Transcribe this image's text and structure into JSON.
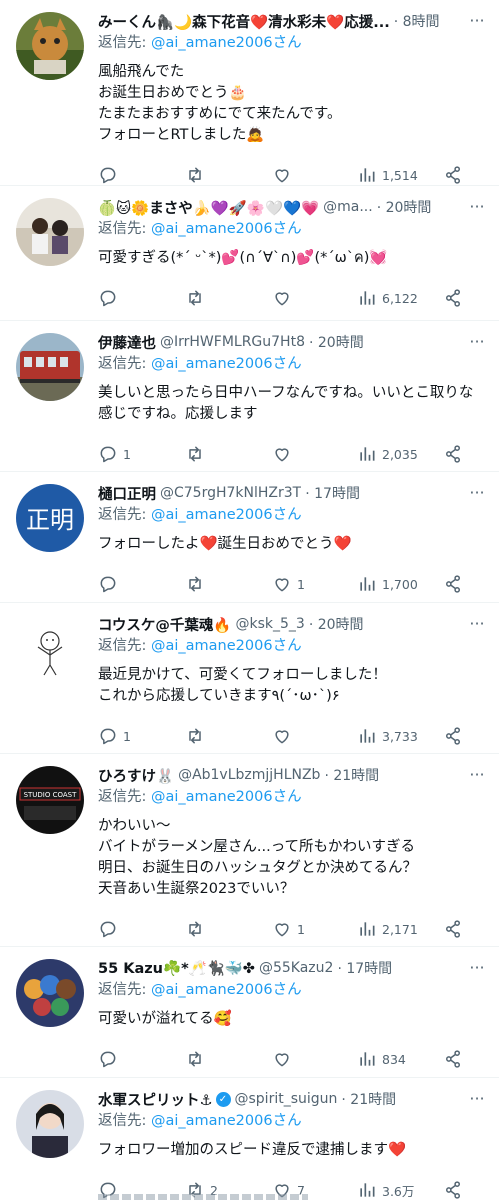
{
  "reply_prefix": "返信先:",
  "reply_target": "@ai_amane2006さん",
  "more_glyph": "···",
  "tweets": [
    {
      "name": "みーくん🦍🌙森下花音❤️清水彩未❤️応援...",
      "handle": "",
      "time": "· 8時間",
      "body": "風船飛んでた\nお誕生日おめでとう🎂\nたまたまおすすめにでて来たんです。\nフォローとRTしました🙇",
      "reply_count": "",
      "retweet_count": "",
      "like_count": "",
      "views": "1,514"
    },
    {
      "name": "🍈🐱🌼まさや🍌💜🚀🌸🤍💙💗",
      "handle": "@ma...",
      "time": "· 20時間",
      "body": "可愛すぎる(*´ ᵕ`*)💕(∩´∀`∩)💕(*´ω`ค)💓",
      "reply_count": "",
      "retweet_count": "",
      "like_count": "",
      "views": "6,122"
    },
    {
      "name": "伊藤達也",
      "handle": "@IrrHWFMLRGu7Ht8",
      "time": "· 20時間",
      "body": "美しいと思ったら日中ハーフなんですね。いいとこ取りな感じですね。応援します",
      "reply_count": "1",
      "retweet_count": "",
      "like_count": "",
      "views": "2,035"
    },
    {
      "name": "樋口正明",
      "handle": "@C75rgH7kNlHZr3T",
      "time": "· 17時間",
      "body": "フォローしたよ❤️誕生日おめでとう❤️",
      "reply_count": "",
      "retweet_count": "",
      "like_count": "1",
      "views": "1,700",
      "avatar_text": "正明"
    },
    {
      "name": "コウスケ@千葉魂🔥",
      "handle": "@ksk_5_3",
      "time": "· 20時間",
      "body": "最近見かけて、可愛くてフォローしました！\nこれから応援していきます٩(´･ω･`)۶",
      "reply_count": "1",
      "retweet_count": "",
      "like_count": "",
      "views": "3,733"
    },
    {
      "name": "ひろすけ🐰",
      "handle": "@Ab1vLbzmjjHLNZb",
      "time": "· 21時間",
      "body": "かわいい〜\nバイトがラーメン屋さん...って所もかわいすぎる\n明日、お誕生日のハッシュタグとか決めてるん？\n天音あい生誕祭2023でいい？",
      "reply_count": "",
      "retweet_count": "",
      "like_count": "1",
      "views": "2,171",
      "avatar_text": "STUDIO COAST"
    },
    {
      "name": "55 Kazu☘️*🥂🐈‍⬛🐳✤",
      "handle": "@55Kazu2",
      "time": "· 17時間",
      "body": "可愛いが溢れてる🥰",
      "reply_count": "",
      "retweet_count": "",
      "like_count": "",
      "views": "834"
    },
    {
      "name": "水軍スピリット⚓",
      "handle": "@spirit_suigun",
      "time": "· 21時間",
      "body": "フォロワー増加のスピード違反で逮捕します❤️",
      "reply_count": "",
      "retweet_count": "2",
      "like_count": "7",
      "views": "3.6万"
    }
  ],
  "colors": {
    "link": "#1d9bf0",
    "muted": "#536471",
    "divider": "#eff3f4"
  },
  "icons": [
    "reply-icon",
    "retweet-icon",
    "like-icon",
    "views-icon",
    "share-icon",
    "more-icon",
    "verified-icon"
  ]
}
